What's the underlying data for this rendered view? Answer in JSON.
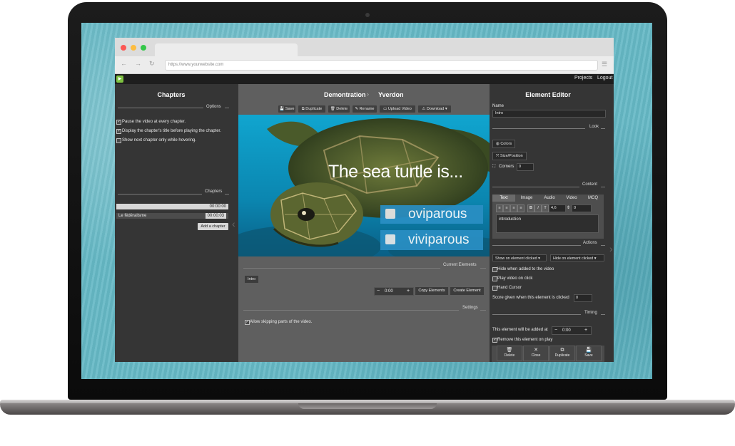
{
  "browser": {
    "url": "https://www.yourwebsite.com"
  },
  "topbar": {
    "projects": "Projects",
    "logout": "Logout"
  },
  "chapters": {
    "title": "Chapters",
    "options_label": "Options",
    "options": [
      {
        "label": "Pause the video at every chapter.",
        "checked": true
      },
      {
        "label": "Display the chapter's title before playing the chapter.",
        "checked": true
      },
      {
        "label": "Show next chapter only while hovering.",
        "checked": false
      }
    ],
    "chapters_label": "Chapters",
    "list": [
      {
        "name": "",
        "time": "00:00:00"
      },
      {
        "name": "Le fédéralisme",
        "time": "00:00:03"
      }
    ],
    "add_button": "Add a chapter"
  },
  "center": {
    "breadcrumb": [
      "Demontration",
      "Yverdon"
    ],
    "toolbar": [
      "Save",
      "Duplicate",
      "Delete",
      "Rename",
      "Upload Video",
      "Download"
    ],
    "video": {
      "question": "The sea turtle is...",
      "answers": [
        "oviparous",
        "viviparous"
      ]
    },
    "current_elements_label": "Current Elements",
    "element_tag": "Intro",
    "time_value": "0:00",
    "copy_elements": "Copy Elements",
    "create_element": "Create Element",
    "settings_label": "Settings",
    "allow_skipping": "Allow skipping parts of the video."
  },
  "editor": {
    "title": "Element Editor",
    "name_label": "Name",
    "name_value": "Intro",
    "look_label": "Look",
    "colors": "Colors",
    "size_position": "Size/Position",
    "corners_label": "Corners",
    "corners_value": "0",
    "content_label": "Content",
    "tabs": [
      "Text",
      "Image",
      "Audio",
      "Video",
      "MCQ"
    ],
    "font_size": "4,6",
    "spacing": "0",
    "text_value": "introduction",
    "actions_label": "Actions",
    "show_on_click": "Show on element clicked",
    "hide_on_click": "Hide on element clicked",
    "action_opts": [
      {
        "label": "Hide when added to the video",
        "checked": false
      },
      {
        "label": "Play video on click",
        "checked": false
      },
      {
        "label": "Hand Cursor",
        "checked": false
      }
    ],
    "score_label": "Score given when this element is clicked",
    "score_value": "0",
    "timing_label": "Timing",
    "added_at_label": "This element will be added at",
    "added_at_value": "0:00",
    "remove_on_play": "Remove this element on play",
    "footer": [
      "Delete",
      "Close",
      "Duplicate",
      "Save"
    ]
  },
  "colors": {
    "accent_green": "#7ec241",
    "video_water": "#0e8fb3",
    "answer_box": "#2a8fc4"
  }
}
